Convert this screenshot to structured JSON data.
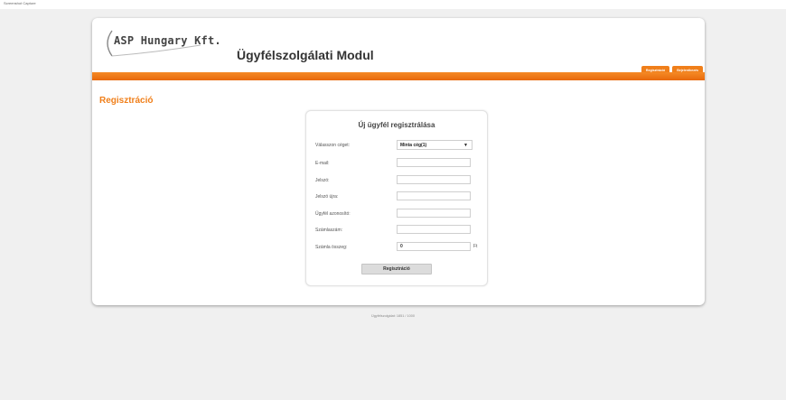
{
  "window": {
    "caption": "Screenshot Capture"
  },
  "header": {
    "logo_text": "ASP Hungary Kft.",
    "app_title": "Ügyfélszolgálati Modul",
    "tabs": [
      {
        "label": "Regisztráció"
      },
      {
        "label": "Bejelentkezés"
      }
    ]
  },
  "page": {
    "heading": "Regisztráció"
  },
  "form": {
    "title": "Új ügyfél regisztrálása",
    "fields": {
      "company": {
        "label": "Válasszon céget:",
        "value": "Minta cég(1)"
      },
      "email": {
        "label": "E-mail:",
        "value": ""
      },
      "password": {
        "label": "Jelszó:",
        "value": ""
      },
      "password_again": {
        "label": "Jelszó újra:",
        "value": ""
      },
      "customer_id": {
        "label": "Ügyfél azonosító:",
        "value": ""
      },
      "account_number": {
        "label": "Számlaszám:",
        "value": ""
      },
      "invoice_amount": {
        "label": "Számla összeg:",
        "value": "0",
        "unit": "Ft"
      }
    },
    "submit_label": "Regisztráció"
  },
  "footer": {
    "text": "Ügyfélszolgálat: 1851 / 1000"
  },
  "colors": {
    "accent": "#f07f1a",
    "band": "#e8690c",
    "background": "#f0f0f0"
  }
}
